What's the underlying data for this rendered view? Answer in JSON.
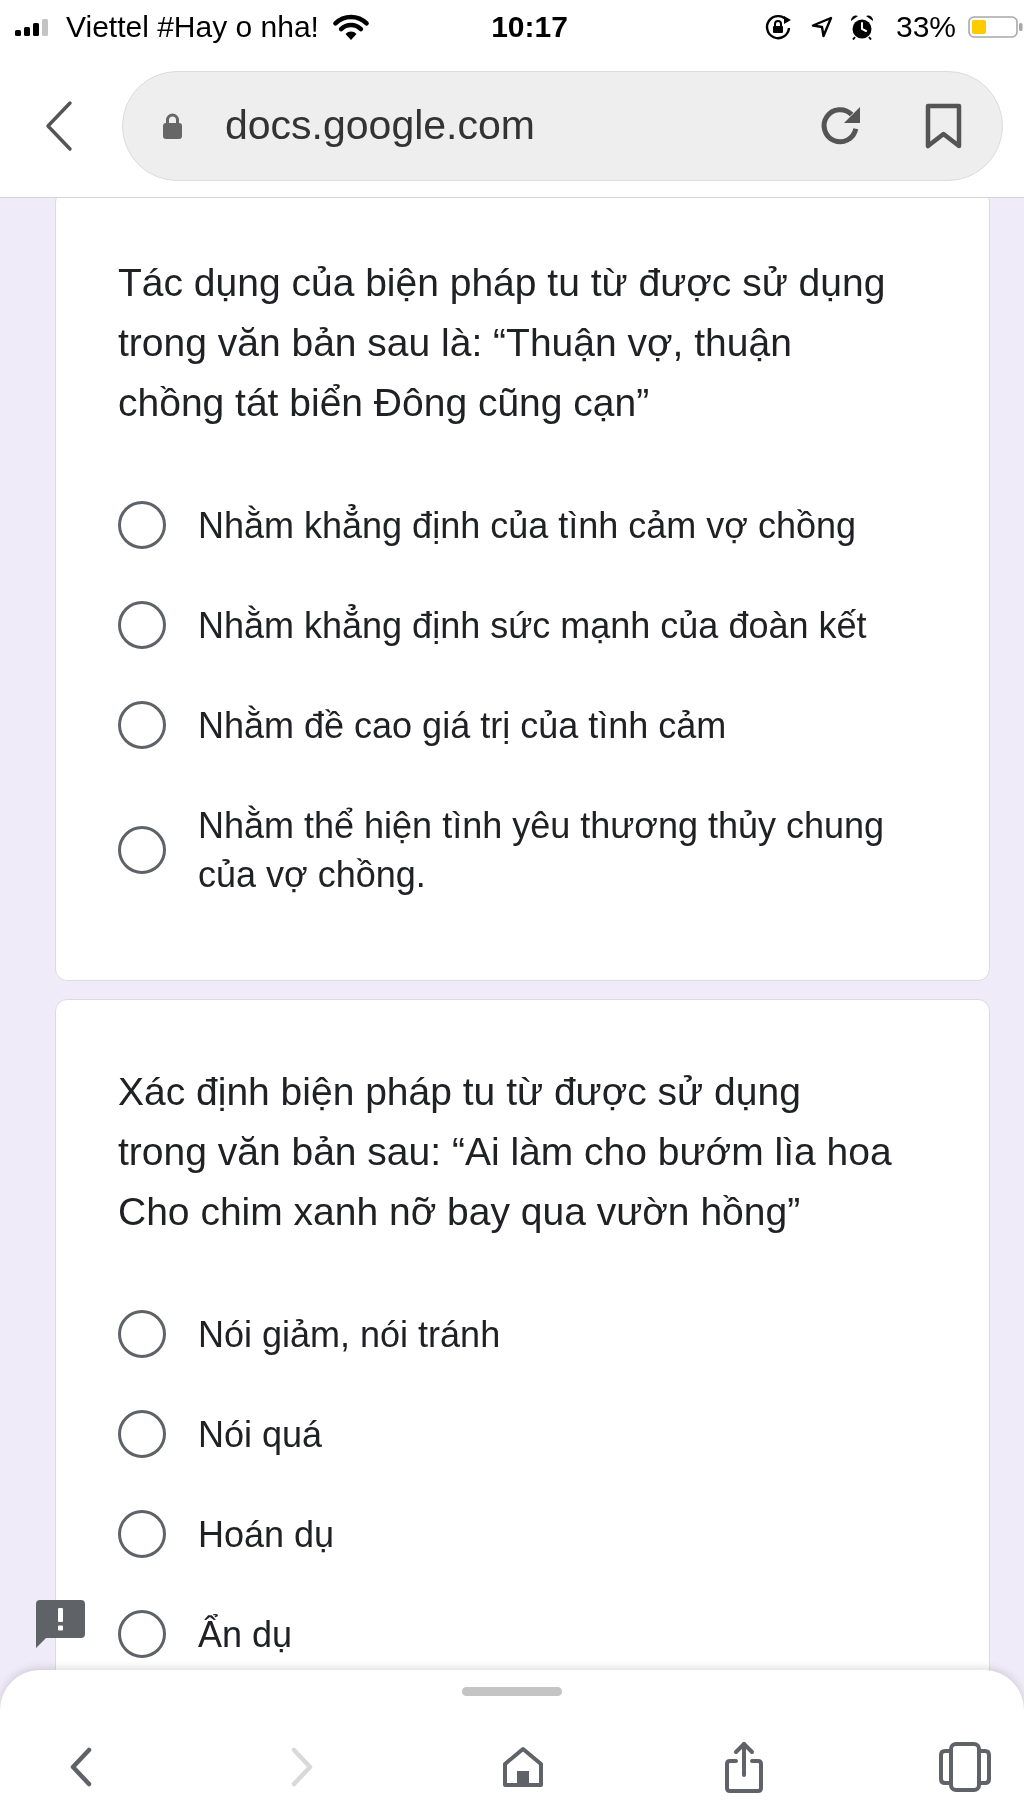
{
  "status_bar": {
    "carrier": "Viettel #Hay o nha!",
    "time": "10:17",
    "battery_percent": "33%"
  },
  "address_bar": {
    "url": "docs.google.com"
  },
  "questions": [
    {
      "text": "Tác dụng của biện pháp tu từ được sử dụng trong văn bản sau là: “Thuận vợ, thuận chồng tát biển Đông cũng cạn”",
      "options": [
        {
          "label": "Nhằm khẳng định của tình cảm vợ chồng",
          "selected": false
        },
        {
          "label": "Nhằm khẳng định sức mạnh của đoàn kết",
          "selected": false
        },
        {
          "label": "Nhằm đề cao giá trị của tình cảm",
          "selected": false
        },
        {
          "label": "Nhằm thể hiện tình yêu thương thủy chung của vợ chồng.",
          "selected": false
        }
      ]
    },
    {
      "text": "Xác định biện pháp tu từ được sử dụng trong văn bản sau: “Ai làm cho bướm lìa hoa Cho chim xanh nỡ bay qua vườn hồng”",
      "options": [
        {
          "label": "Nói giảm, nói tránh",
          "selected": false
        },
        {
          "label": "Nói quá",
          "selected": false
        },
        {
          "label": "Hoán dụ",
          "selected": false
        },
        {
          "label": "Ẩn dụ",
          "selected": false
        }
      ]
    }
  ],
  "toolbar": {
    "buttons": [
      {
        "disabled": false
      },
      {
        "disabled": true
      },
      {
        "disabled": false
      },
      {
        "disabled": false
      },
      {
        "disabled": false
      }
    ]
  }
}
